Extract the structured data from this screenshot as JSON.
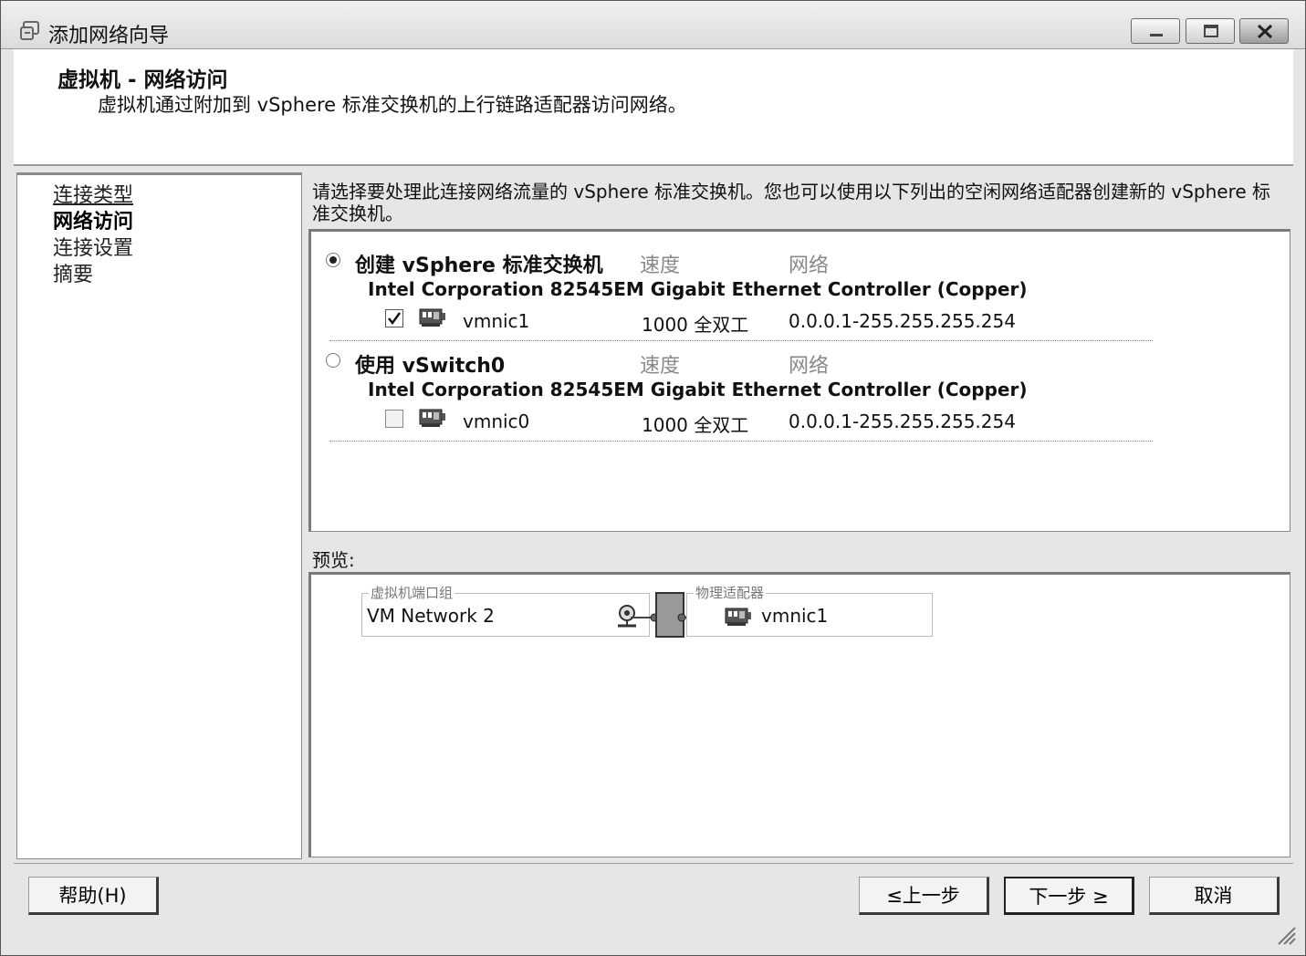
{
  "window": {
    "title": "添加网络向导",
    "controls": [
      "minimize",
      "maximize",
      "close"
    ]
  },
  "header": {
    "title": "虚拟机 - 网络访问",
    "subtitle": "虚拟机通过附加到 vSphere 标准交换机的上行链路适配器访问网络。"
  },
  "nav": {
    "items": [
      {
        "label": "连接类型",
        "state": "link"
      },
      {
        "label": "网络访问",
        "state": "active"
      },
      {
        "label": "连接设置",
        "state": "normal"
      },
      {
        "label": "摘要",
        "state": "normal"
      }
    ]
  },
  "instruction": "请选择要处理此连接网络流量的 vSphere 标准交换机。您也可以使用以下列出的空闲网络适配器创建新的 vSphere 标准交换机。",
  "options": [
    {
      "label": "创建 vSphere 标准交换机",
      "selected": true,
      "speed_header": "速度",
      "network_header": "网络",
      "adapter": "Intel Corporation 82545EM Gigabit Ethernet Controller (Copper)",
      "nic": {
        "name": "vmnic1",
        "checked": true,
        "speed": "1000 全双工",
        "network": "0.0.0.1-255.255.255.254"
      }
    },
    {
      "label": "使用 vSwitch0",
      "selected": false,
      "speed_header": "速度",
      "network_header": "网络",
      "adapter": "Intel Corporation 82545EM Gigabit Ethernet Controller (Copper)",
      "nic": {
        "name": "vmnic0",
        "checked": false,
        "speed": "1000 全双工",
        "network": "0.0.0.1-255.255.255.254"
      }
    }
  ],
  "preview": {
    "label": "预览:",
    "port_group_caption": "虚拟机端口组",
    "port_group_name": "VM Network 2",
    "physical_caption": "物理适配器",
    "physical_nic": "vmnic1"
  },
  "buttons": {
    "help": "帮助(H)",
    "back": "≤上一步",
    "next": "下一步 ≥",
    "cancel": "取消"
  }
}
